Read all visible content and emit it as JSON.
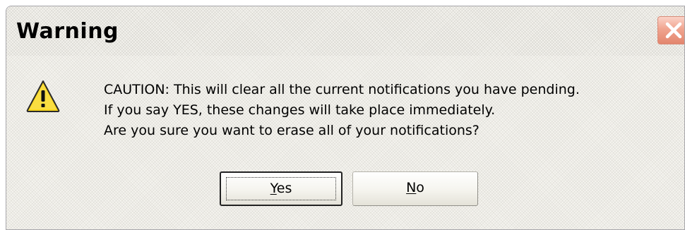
{
  "window": {
    "title": "Warning",
    "close_icon": "close-icon"
  },
  "message": {
    "icon": "warning-icon",
    "lines": [
      "CAUTION: This will clear all the current notifications you have pending.",
      "If you say YES, these changes will take place immediately.",
      "Are you sure you want to erase all of your notifications?"
    ]
  },
  "buttons": {
    "yes": {
      "mnemonic": "Y",
      "rest": "es"
    },
    "no": {
      "mnemonic": "N",
      "rest": "o"
    }
  },
  "colors": {
    "close_button": "#e3866e",
    "warning_fill": "#f7d51d"
  }
}
